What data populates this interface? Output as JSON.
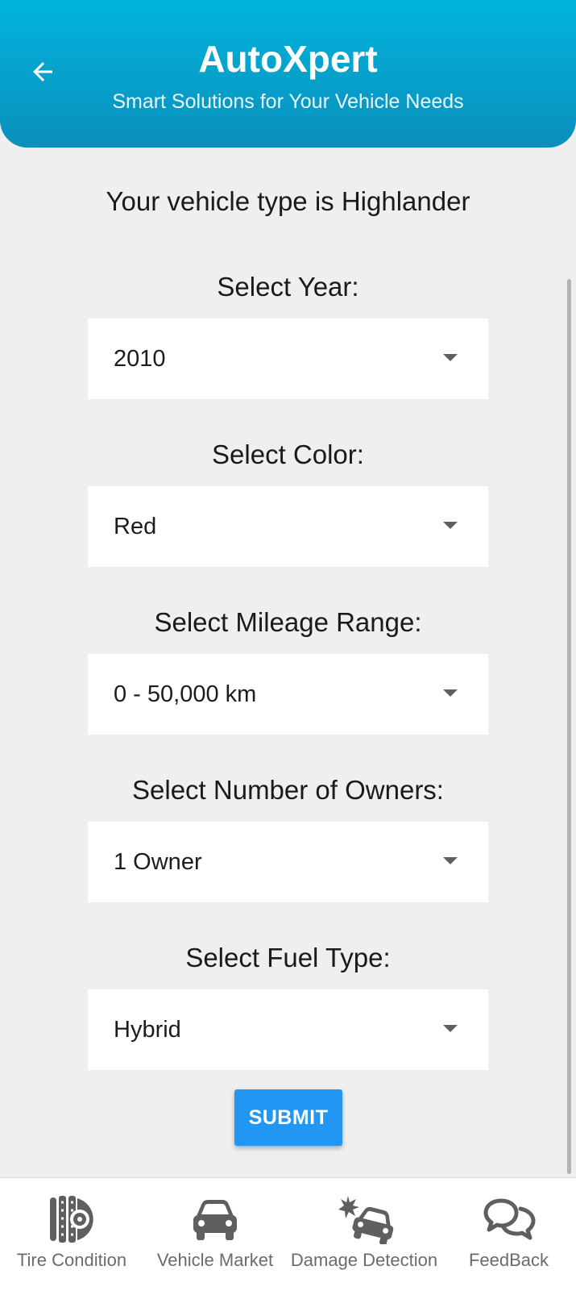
{
  "header": {
    "title": "AutoXpert",
    "subtitle": "Smart Solutions for Your Vehicle Needs",
    "back_icon": "arrow-left-icon"
  },
  "vehicle_type_text": "Your vehicle type is Highlander",
  "form": {
    "year": {
      "label": "Select Year:",
      "value": "2010"
    },
    "color": {
      "label": "Select Color:",
      "value": "Red"
    },
    "mileage": {
      "label": "Select Mileage Range:",
      "value": "0 - 50,000 km"
    },
    "owners": {
      "label": "Select Number of Owners:",
      "value": "1 Owner"
    },
    "fuel": {
      "label": "Select Fuel Type:",
      "value": "Hybrid"
    },
    "submit_label": "SUBMIT"
  },
  "bottom_nav": {
    "items": [
      {
        "label": "Tire Condition",
        "icon": "tire-icon"
      },
      {
        "label": "Vehicle Market",
        "icon": "car-icon"
      },
      {
        "label": "Damage Detection",
        "icon": "car-crash-icon"
      },
      {
        "label": "FeedBack",
        "icon": "chat-bubbles-icon"
      }
    ]
  },
  "colors": {
    "header_top": "#02b4dc",
    "header_bottom": "#0a8fbc",
    "submit": "#2196f3",
    "background": "#efefef",
    "nav_icon": "#5f5f5f"
  }
}
